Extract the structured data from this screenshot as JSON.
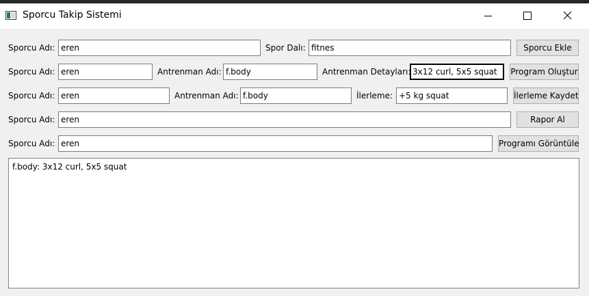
{
  "window": {
    "title": "Sporcu Takip Sistemi",
    "icon": "app-window-icon",
    "controls": [
      "minimize-icon",
      "maximize-icon",
      "close-icon"
    ]
  },
  "rows": {
    "add": {
      "athlete_label": "Sporcu Adı:",
      "athlete_value": "eren",
      "sport_label": "Spor Dalı:",
      "sport_value": "fitnes",
      "button": "Sporcu Ekle"
    },
    "program": {
      "athlete_label": "Sporcu Adı:",
      "athlete_value": "eren",
      "training_label": "Antrenman Adı:",
      "training_value": "f.body",
      "details_label": "Antrenman Detayları:",
      "details_value": "3x12 curl, 5x5 squat",
      "button": "Program Oluştur"
    },
    "progress": {
      "athlete_label": "Sporcu Adı:",
      "athlete_value": "eren",
      "training_label": "Antrenman Adı:",
      "training_value": "f.body",
      "progress_label": "İlerleme:",
      "progress_value": "+5 kg squat",
      "button": "İlerleme Kaydet"
    },
    "report": {
      "athlete_label": "Sporcu Adı:",
      "athlete_value": "eren",
      "button": "Rapor Al"
    },
    "view": {
      "athlete_label": "Sporcu Adı:",
      "athlete_value": "eren",
      "button": "Programı Görüntüle"
    }
  },
  "output": {
    "lines": [
      "f.body: 3x12 curl, 5x5 squat"
    ]
  }
}
